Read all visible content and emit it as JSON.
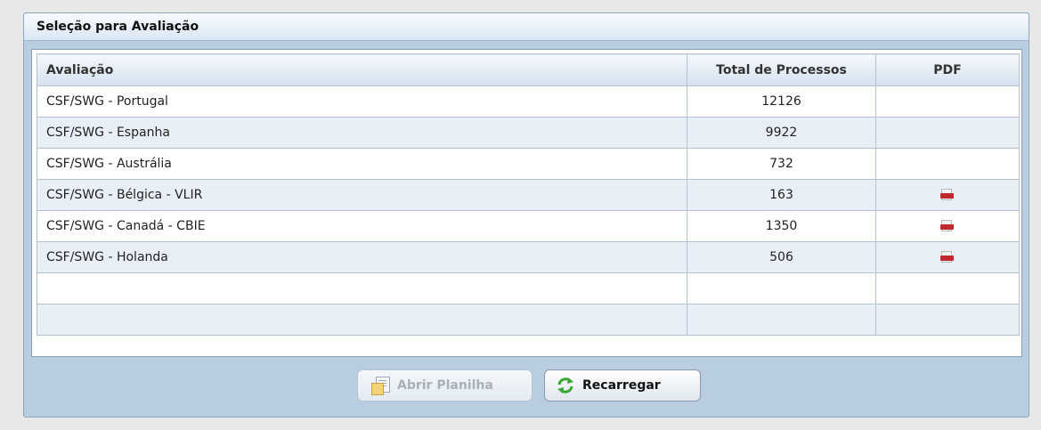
{
  "panel": {
    "title": "Seleção para Avaliação"
  },
  "table": {
    "columns": [
      "Avaliação",
      "Total de Processos",
      "PDF"
    ],
    "rows": [
      {
        "name": "CSF/SWG - Portugal",
        "total": "12126",
        "pdf": false
      },
      {
        "name": "CSF/SWG - Espanha",
        "total": "9922",
        "pdf": false
      },
      {
        "name": "CSF/SWG - Austrália",
        "total": "732",
        "pdf": false
      },
      {
        "name": "CSF/SWG - Bélgica - VLIR",
        "total": "163",
        "pdf": true
      },
      {
        "name": "CSF/SWG - Canadá - CBIE",
        "total": "1350",
        "pdf": true
      },
      {
        "name": "CSF/SWG - Holanda",
        "total": "506",
        "pdf": true
      },
      {
        "name": "",
        "total": "",
        "pdf": false
      },
      {
        "name": "",
        "total": "",
        "pdf": false
      }
    ],
    "pdf_icon": "pdf-file-icon"
  },
  "buttons": {
    "open_label": "Abrir Planilha",
    "open_icon": "spreadsheet-icon",
    "open_enabled": false,
    "reload_label": "Recarregar",
    "reload_icon": "refresh-icon"
  },
  "colors": {
    "panel_bg": "#b9cde0",
    "row_alt": "#e9eff7",
    "pdf_red": "#c0282d",
    "reload_green": "#3aa635"
  }
}
